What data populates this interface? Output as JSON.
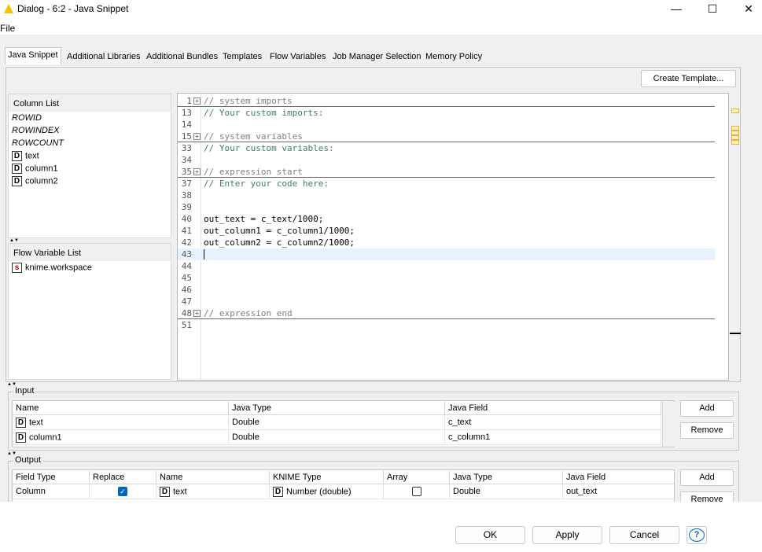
{
  "window": {
    "title": "Dialog - 6:2 - Java Snippet",
    "controls": {
      "minimize": "—",
      "maximize": "☐",
      "close": "✕"
    }
  },
  "menu": {
    "file": "File"
  },
  "tabs": [
    {
      "label": "Java Snippet",
      "active": true
    },
    {
      "label": "Additional Libraries"
    },
    {
      "label": "Additional Bundles"
    },
    {
      "label": "Templates"
    },
    {
      "label": "Flow Variables"
    },
    {
      "label": "Job Manager Selection"
    },
    {
      "label": "Memory Policy"
    }
  ],
  "create_template": "Create Template...",
  "column_list": {
    "header": "Column List",
    "items": [
      "ROWID",
      "ROWINDEX",
      "ROWCOUNT",
      "text",
      "column1",
      "column2"
    ],
    "type_icon": "D"
  },
  "flow_variable_list": {
    "header": "Flow Variable List",
    "items": [
      "knime.workspace"
    ],
    "type_icon": "s"
  },
  "editor": {
    "lines": [
      {
        "n": "1",
        "text": "// system imports",
        "kind": "guarded",
        "fold": true,
        "sep": true
      },
      {
        "n": "13",
        "text": "// Your custom imports:",
        "kind": "comment"
      },
      {
        "n": "14",
        "text": ""
      },
      {
        "n": "15",
        "text": "// system variables",
        "kind": "guarded",
        "fold": true,
        "sep": true
      },
      {
        "n": "33",
        "text": "// Your custom variables:",
        "kind": "comment"
      },
      {
        "n": "34",
        "text": ""
      },
      {
        "n": "35",
        "text": "// expression start",
        "kind": "guarded",
        "fold": true,
        "sep": true
      },
      {
        "n": "37",
        "text": "// Enter your code here:",
        "kind": "comment"
      },
      {
        "n": "38",
        "text": ""
      },
      {
        "n": "39",
        "text": ""
      },
      {
        "n": "40",
        "text": "out_text = c_text/1000;"
      },
      {
        "n": "41",
        "text": "out_column1 = c_column1/1000;"
      },
      {
        "n": "42",
        "text": "out_column2 = c_column2/1000;"
      },
      {
        "n": "43",
        "text": "",
        "current": true
      },
      {
        "n": "44",
        "text": ""
      },
      {
        "n": "45",
        "text": ""
      },
      {
        "n": "46",
        "text": ""
      },
      {
        "n": "47",
        "text": ""
      },
      {
        "n": "48",
        "text": "// expression end",
        "kind": "guarded",
        "fold": true,
        "sep": true
      },
      {
        "n": "51",
        "text": ""
      }
    ]
  },
  "input": {
    "label": "Input",
    "headers": [
      "Name",
      "Java Type",
      "Java Field"
    ],
    "rows": [
      [
        "text",
        "Double",
        "c_text"
      ],
      [
        "column1",
        "Double",
        "c_column1"
      ]
    ],
    "add": "Add",
    "remove": "Remove"
  },
  "output": {
    "label": "Output",
    "headers": [
      "Field Type",
      "Replace",
      "Name",
      "KNIME Type",
      "Array",
      "Java Type",
      "Java Field"
    ],
    "rows": [
      {
        "field_type": "Column",
        "replace": true,
        "name": "text",
        "knime_type": "Number (double)",
        "array": false,
        "java_type": "Double",
        "java_field": "out_text"
      }
    ],
    "add": "Add",
    "remove": "Remove"
  },
  "footer": {
    "ok": "OK",
    "apply": "Apply",
    "cancel": "Cancel",
    "help": "?"
  },
  "colors": {
    "accent": "#0067c0",
    "title_icon": "#f5c400"
  }
}
